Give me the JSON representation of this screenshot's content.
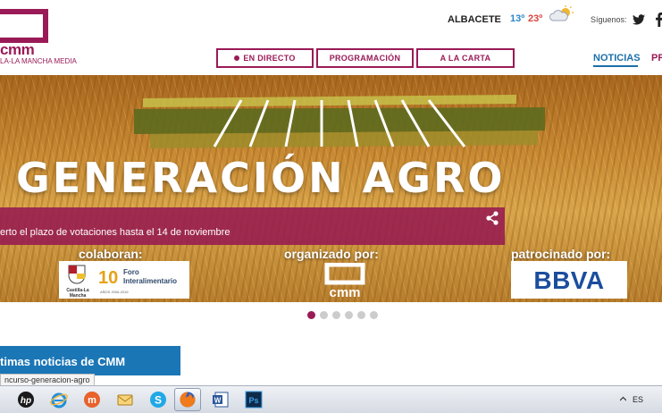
{
  "header": {
    "logo_text": "cmm",
    "logo_subtitle": "LA-LA MANCHA MEDIA",
    "city": "ALBACETE",
    "temp_min": "13º",
    "temp_max": "23º",
    "follow_label": "Síguenos:",
    "weather_icon": "partly-cloudy-icon",
    "social_icons": [
      "twitter-icon",
      "facebook-icon"
    ]
  },
  "nav": {
    "live_label": "EN DIRECTO",
    "programming_label": "PROGRAMACIÓN",
    "on_demand_label": "A LA CARTA",
    "tab_news": "NOTICIAS",
    "tab_next": "PR"
  },
  "hero": {
    "title": "GENERACIÓN AGRO",
    "caption": "erto el plazo de votaciones hasta el 14 de noviembre",
    "collaborate_label": "colaboran:",
    "organized_label": "organizado por:",
    "sponsored_label": "patrocinado por:",
    "sponsor_left_name": "Castilla-La Mancha",
    "foro_number": "10",
    "foro_line1": "Foro",
    "foro_line2": "Interalimentario",
    "foro_years": "AÑOS 2006-2016",
    "organizer_name": "cmm",
    "sponsor_name": "BBVA",
    "slides_total": 6,
    "slide_active": 1
  },
  "latest": {
    "title": "timas noticias de CMM"
  },
  "status_bar": {
    "url": "ncurso-generacion-agro"
  },
  "taskbar": {
    "apps": [
      "hp-icon",
      "internet-explorer-icon",
      "mozilla-icon",
      "mail-icon",
      "skype-icon",
      "firefox-icon",
      "word-icon",
      "photoshop-icon"
    ],
    "active_app": "firefox-icon",
    "language": "ES"
  },
  "colors": {
    "brand": "#9a1a57",
    "accent_blue": "#1b76b6",
    "bbva_blue": "#1b4d9e"
  }
}
